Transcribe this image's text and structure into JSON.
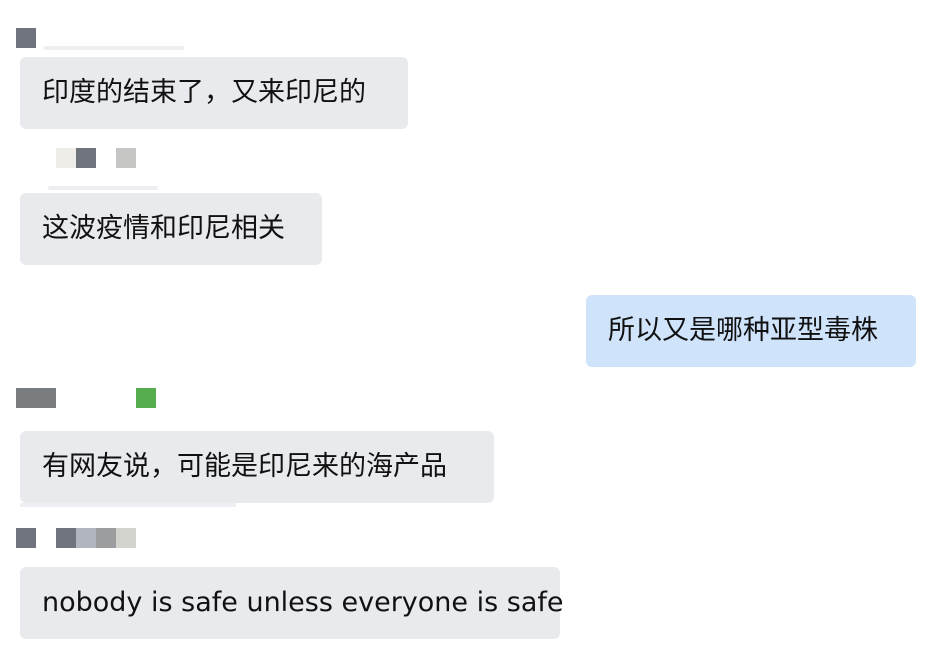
{
  "messages": [
    {
      "direction": "incoming",
      "text": "印度的结束了，又来印尼的"
    },
    {
      "direction": "incoming",
      "text": "这波疫情和印尼相关"
    },
    {
      "direction": "outgoing",
      "text": "所以又是哪种亚型毒株"
    },
    {
      "direction": "incoming",
      "text": "有网友说，可能是印尼来的海产品"
    },
    {
      "direction": "incoming",
      "text": "nobody is safe unless everyone is safe"
    }
  ],
  "colors": {
    "incoming_bubble": "#e9eaed",
    "outgoing_bubble": "#cfe4fb",
    "text": "#111111",
    "mosaic_accent": "#54ac4e"
  }
}
